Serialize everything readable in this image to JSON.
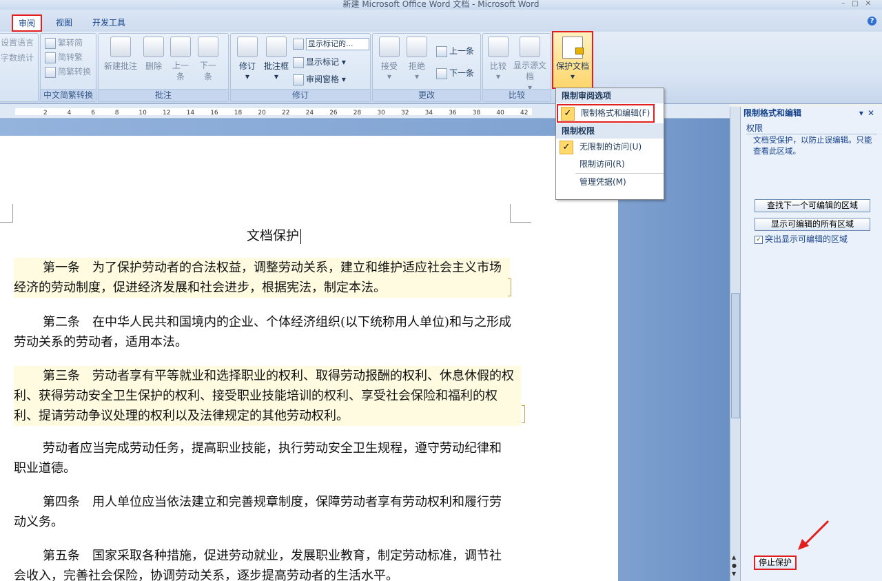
{
  "window": {
    "title": "新建 Microsoft Office Word 文档 - Microsoft Word"
  },
  "tabs": [
    {
      "label": "审阅",
      "active": true
    },
    {
      "label": "视图",
      "active": false
    },
    {
      "label": "开发工具",
      "active": false
    }
  ],
  "ribbon": {
    "proofing": {
      "items": [
        "设置语言",
        "字数统计"
      ]
    },
    "chinese_conversion": {
      "label": "中文简繁转换",
      "items": [
        "繁转简",
        "简转繁",
        "简繁转换"
      ]
    },
    "comments": {
      "label": "批注",
      "new": "新建批注",
      "delete": "删除",
      "prev": "上一条",
      "next": "下一条"
    },
    "tracking": {
      "label": "修订",
      "track": "修订",
      "balloons": "批注框",
      "display_combo": "显示标记的...",
      "show_markup": "显示标记",
      "review_pane": "审阅窗格"
    },
    "changes": {
      "label": "更改",
      "accept": "接受",
      "reject": "拒绝",
      "prev": "上一条",
      "next": "下一条"
    },
    "compare": {
      "label": "比较",
      "compare": "比较",
      "show_source": "显示源文档"
    },
    "protect": {
      "label": "保护文档"
    }
  },
  "ruler": {
    "ticks": [
      "2",
      "4",
      "6",
      "8",
      "10",
      "12",
      "14",
      "16",
      "18",
      "20",
      "22",
      "24",
      "26",
      "28",
      "30",
      "32",
      "34",
      "36",
      "38",
      "40",
      "42"
    ]
  },
  "dropdown": {
    "section1": "限制审阅选项",
    "restrict_formatting": "限制格式和编辑(F)",
    "section2": "限制权限",
    "unrestricted": "无限制的访问(U)",
    "restricted": "限制访问(R)",
    "manage": "管理凭据(M)"
  },
  "document": {
    "title": "文档保护",
    "paragraphs": [
      {
        "text": "第一条　为了保护劳动者的合法权益，调整劳动关系，建立和维护适应社会主义市场经济的劳动制度，促进经济发展和社会进步，根据宪法，制定本法。",
        "editable": true
      },
      {
        "text": "第二条　在中华人民共和国境内的企业、个体经济组织(以下统称用人单位)和与之形成劳动关系的劳动者，适用本法。",
        "editable": false
      },
      {
        "text": "第三条　劳动者享有平等就业和选择职业的权利、取得劳动报酬的权利、休息休假的权利、获得劳动安全卫生保护的权利、接受职业技能培训的权利、享受社会保险和福利的权利、提请劳动争议处理的权利以及法律规定的其他劳动权利。",
        "editable": true
      },
      {
        "text": "劳动者应当完成劳动任务，提高职业技能，执行劳动安全卫生规程，遵守劳动纪律和职业道德。",
        "editable": false
      },
      {
        "text": "第四条　用人单位应当依法建立和完善规章制度，保障劳动者享有劳动权利和履行劳动义务。",
        "editable": false
      },
      {
        "text": "第五条　国家采取各种措施，促进劳动就业，发展职业教育，制定劳动标准，调节社会收入，完善社会保险，协调劳动关系，逐步提高劳动者的生活水平。",
        "editable": false
      }
    ]
  },
  "pane": {
    "title": "限制格式和编辑",
    "section": "权限",
    "message": "文档受保护，以防止误编辑。只能查看此区域。",
    "find_next": "查找下一个可编辑的区域",
    "show_all": "显示可编辑的所有区域",
    "highlight": "突出显示可编辑的区域",
    "stop": "停止保护"
  }
}
